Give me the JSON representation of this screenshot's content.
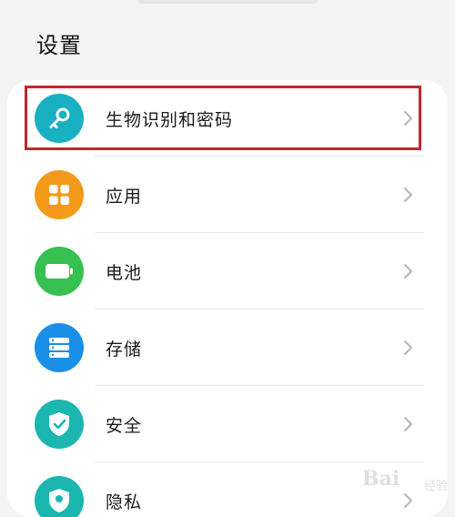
{
  "header": {
    "title": "设置"
  },
  "settings": {
    "items": [
      {
        "label": "生物识别和密码",
        "icon": "key-icon",
        "color": "#19b0c2"
      },
      {
        "label": "应用",
        "icon": "apps-grid-icon",
        "color": "#f39a1a"
      },
      {
        "label": "电池",
        "icon": "battery-icon",
        "color": "#35c04f"
      },
      {
        "label": "存储",
        "icon": "storage-icon",
        "color": "#1a8fe8"
      },
      {
        "label": "安全",
        "icon": "shield-check-icon",
        "color": "#1bb6b0"
      },
      {
        "label": "隐私",
        "icon": "privacy-icon",
        "color": "#1bb6b0"
      }
    ]
  },
  "highlight_color": "#c8232c",
  "watermark": {
    "text": "Bai",
    "sub": "经验"
  }
}
